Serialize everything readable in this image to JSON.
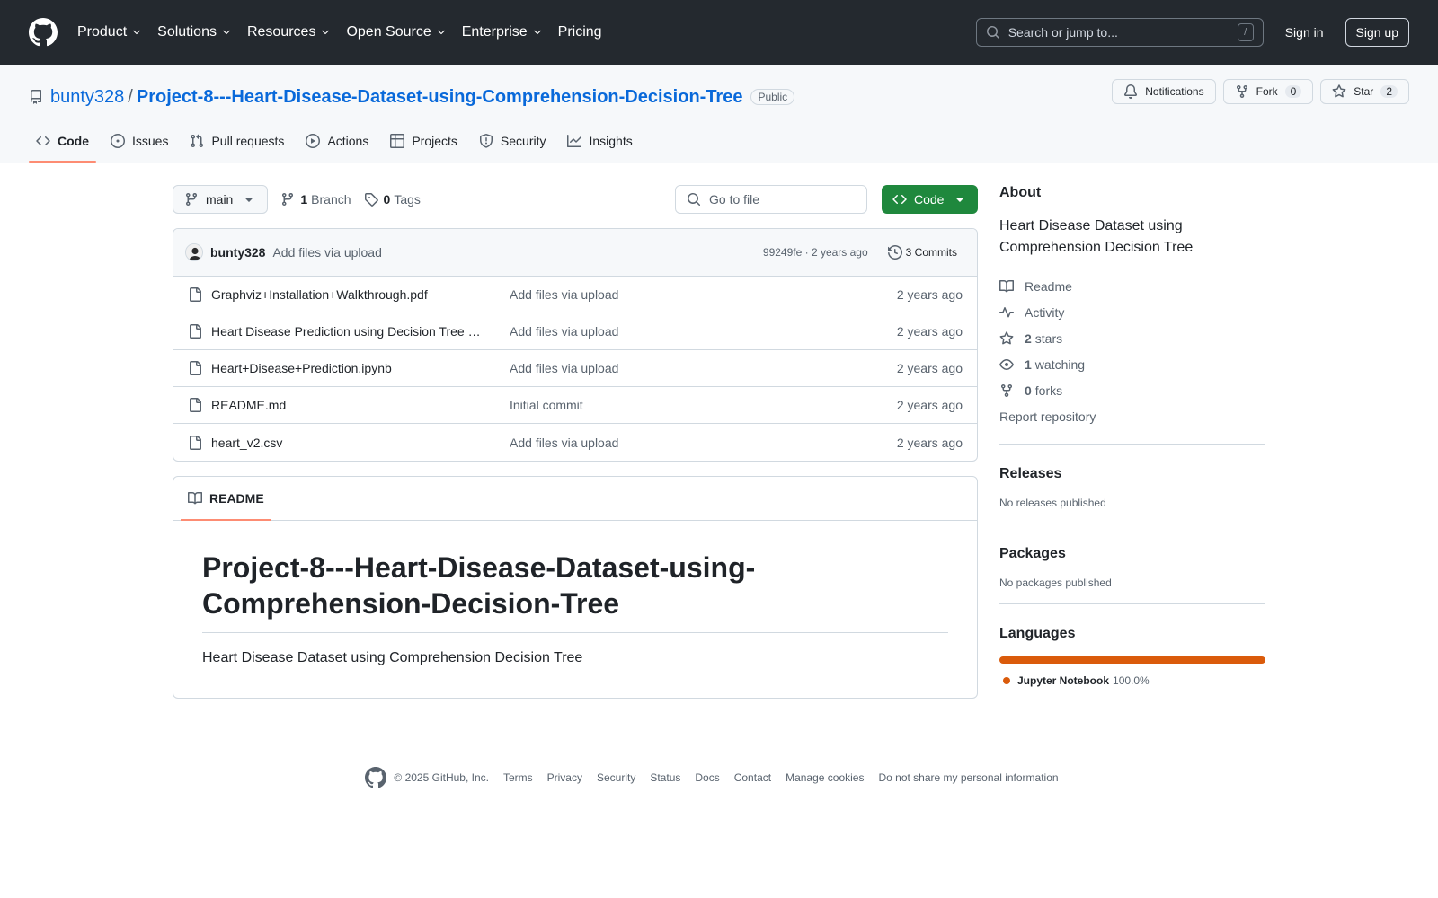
{
  "header": {
    "nav": [
      "Product",
      "Solutions",
      "Resources",
      "Open Source",
      "Enterprise",
      "Pricing"
    ],
    "search_placeholder": "Search or jump to...",
    "search_key": "/",
    "sign_in": "Sign in",
    "sign_up": "Sign up"
  },
  "repo": {
    "owner": "bunty328",
    "separator": "/",
    "name": "Project-8---Heart-Disease-Dataset-using-Comprehension-Decision-Tree",
    "visibility": "Public",
    "notifications_label": "Notifications",
    "fork_label": "Fork",
    "fork_count": "0",
    "star_label": "Star",
    "star_count": "2"
  },
  "tabs": [
    "Code",
    "Issues",
    "Pull requests",
    "Actions",
    "Projects",
    "Security",
    "Insights"
  ],
  "filebar": {
    "branch": "main",
    "branch_count": "1",
    "branch_label": "Branch",
    "tag_count": "0",
    "tag_label": "Tags",
    "goto_placeholder": "Go to file",
    "code_button": "Code"
  },
  "latest_commit": {
    "author": "bunty328",
    "message": "Add files via upload",
    "meta": "99249fe · 2 years ago",
    "commits": "3 Commits"
  },
  "files": [
    {
      "name": "Graphviz+Installation+Walkthrough.pdf",
      "message": "Add files via upload",
      "age": "2 years ago"
    },
    {
      "name": "Heart Disease Prediction using Decision Tree …",
      "message": "Add files via upload",
      "age": "2 years ago"
    },
    {
      "name": "Heart+Disease+Prediction.ipynb",
      "message": "Add files via upload",
      "age": "2 years ago"
    },
    {
      "name": "README.md",
      "message": "Initial commit",
      "age": "2 years ago"
    },
    {
      "name": "heart_v2.csv",
      "message": "Add files via upload",
      "age": "2 years ago"
    }
  ],
  "readme": {
    "tab_label": "README",
    "heading_line1": "Project-8---Heart-Disease-Dataset-using-",
    "heading_line2": "Comprehension-Decision-Tree",
    "body": "Heart Disease Dataset using Comprehension Decision Tree"
  },
  "about": {
    "heading": "About",
    "description": "Heart Disease Dataset using Comprehension Decision Tree",
    "readme": "Readme",
    "activity": "Activity",
    "stars_count": "2",
    "stars_label": "stars",
    "watching_count": "1",
    "watching_label": "watching",
    "forks_count": "0",
    "forks_label": "forks",
    "report": "Report repository"
  },
  "releases": {
    "heading": "Releases",
    "empty": "No releases published"
  },
  "packages": {
    "heading": "Packages",
    "empty": "No packages published"
  },
  "languages": {
    "heading": "Languages",
    "name": "Jupyter Notebook",
    "percent": "100.0%",
    "fraction": 1.0,
    "color": "#da5b0b"
  },
  "footer": {
    "copyright": "© 2025 GitHub, Inc.",
    "links": [
      "Terms",
      "Privacy",
      "Security",
      "Status",
      "Docs",
      "Contact",
      "Manage cookies",
      "Do not share my personal information"
    ]
  },
  "colors": {
    "accent": "#0969da",
    "primary_button": "#1f883d",
    "tab_underline": "#fd8c73",
    "header_bg": "#24292f"
  }
}
